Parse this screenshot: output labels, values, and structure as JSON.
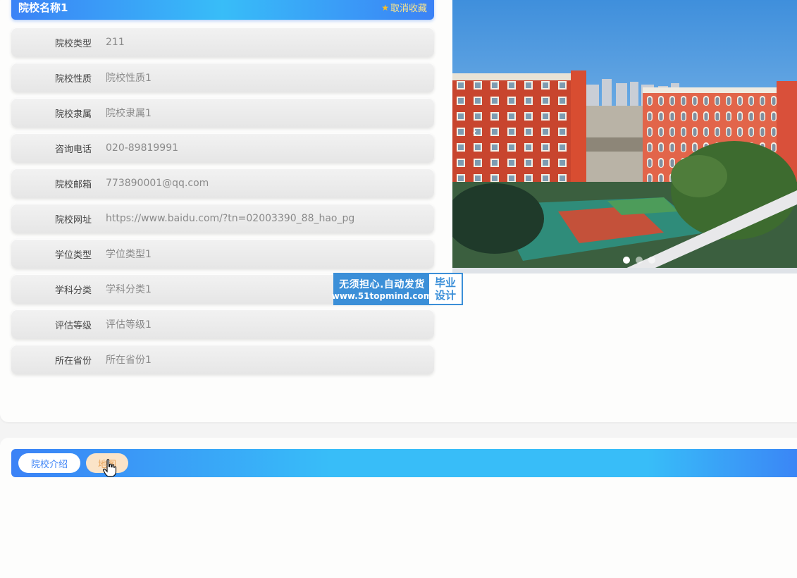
{
  "school": {
    "name": "院校名称1",
    "favorite_label": "取消收藏",
    "favorite_icon": "star-icon"
  },
  "info_rows": [
    {
      "label": "院校类型",
      "value": "211"
    },
    {
      "label": "院校性质",
      "value": "院校性质1"
    },
    {
      "label": "院校隶属",
      "value": "院校隶属1"
    },
    {
      "label": "咨询电话",
      "value": "020-89819991"
    },
    {
      "label": "院校邮箱",
      "value": "773890001@qq.com"
    },
    {
      "label": "院校网址",
      "value": "https://www.baidu.com/?tn=02003390_88_hao_pg"
    },
    {
      "label": "学位类型",
      "value": "学位类型1"
    },
    {
      "label": "学科分类",
      "value": "学科分类1"
    },
    {
      "label": "评估等级",
      "value": "评估等级1"
    },
    {
      "label": "所在省份",
      "value": "所在省份1"
    }
  ],
  "carousel": {
    "prev_icon": "chevron-left-icon",
    "prev_glyph": "‹",
    "slide_count": 3,
    "active_slide": 1
  },
  "watermark": {
    "line1": "无须担心.自动发货",
    "line2": "www.51topmind.com",
    "right1": "毕业",
    "right2": "设计"
  },
  "tabs": [
    {
      "label": "院校介绍",
      "active": false
    },
    {
      "label": "地图",
      "active": true
    }
  ],
  "colors": {
    "accent_blue": "#3b82f6",
    "accent_cyan": "#38bdf8",
    "fav_text": "#fde68a",
    "watermark_blue": "#3b8fd8"
  }
}
